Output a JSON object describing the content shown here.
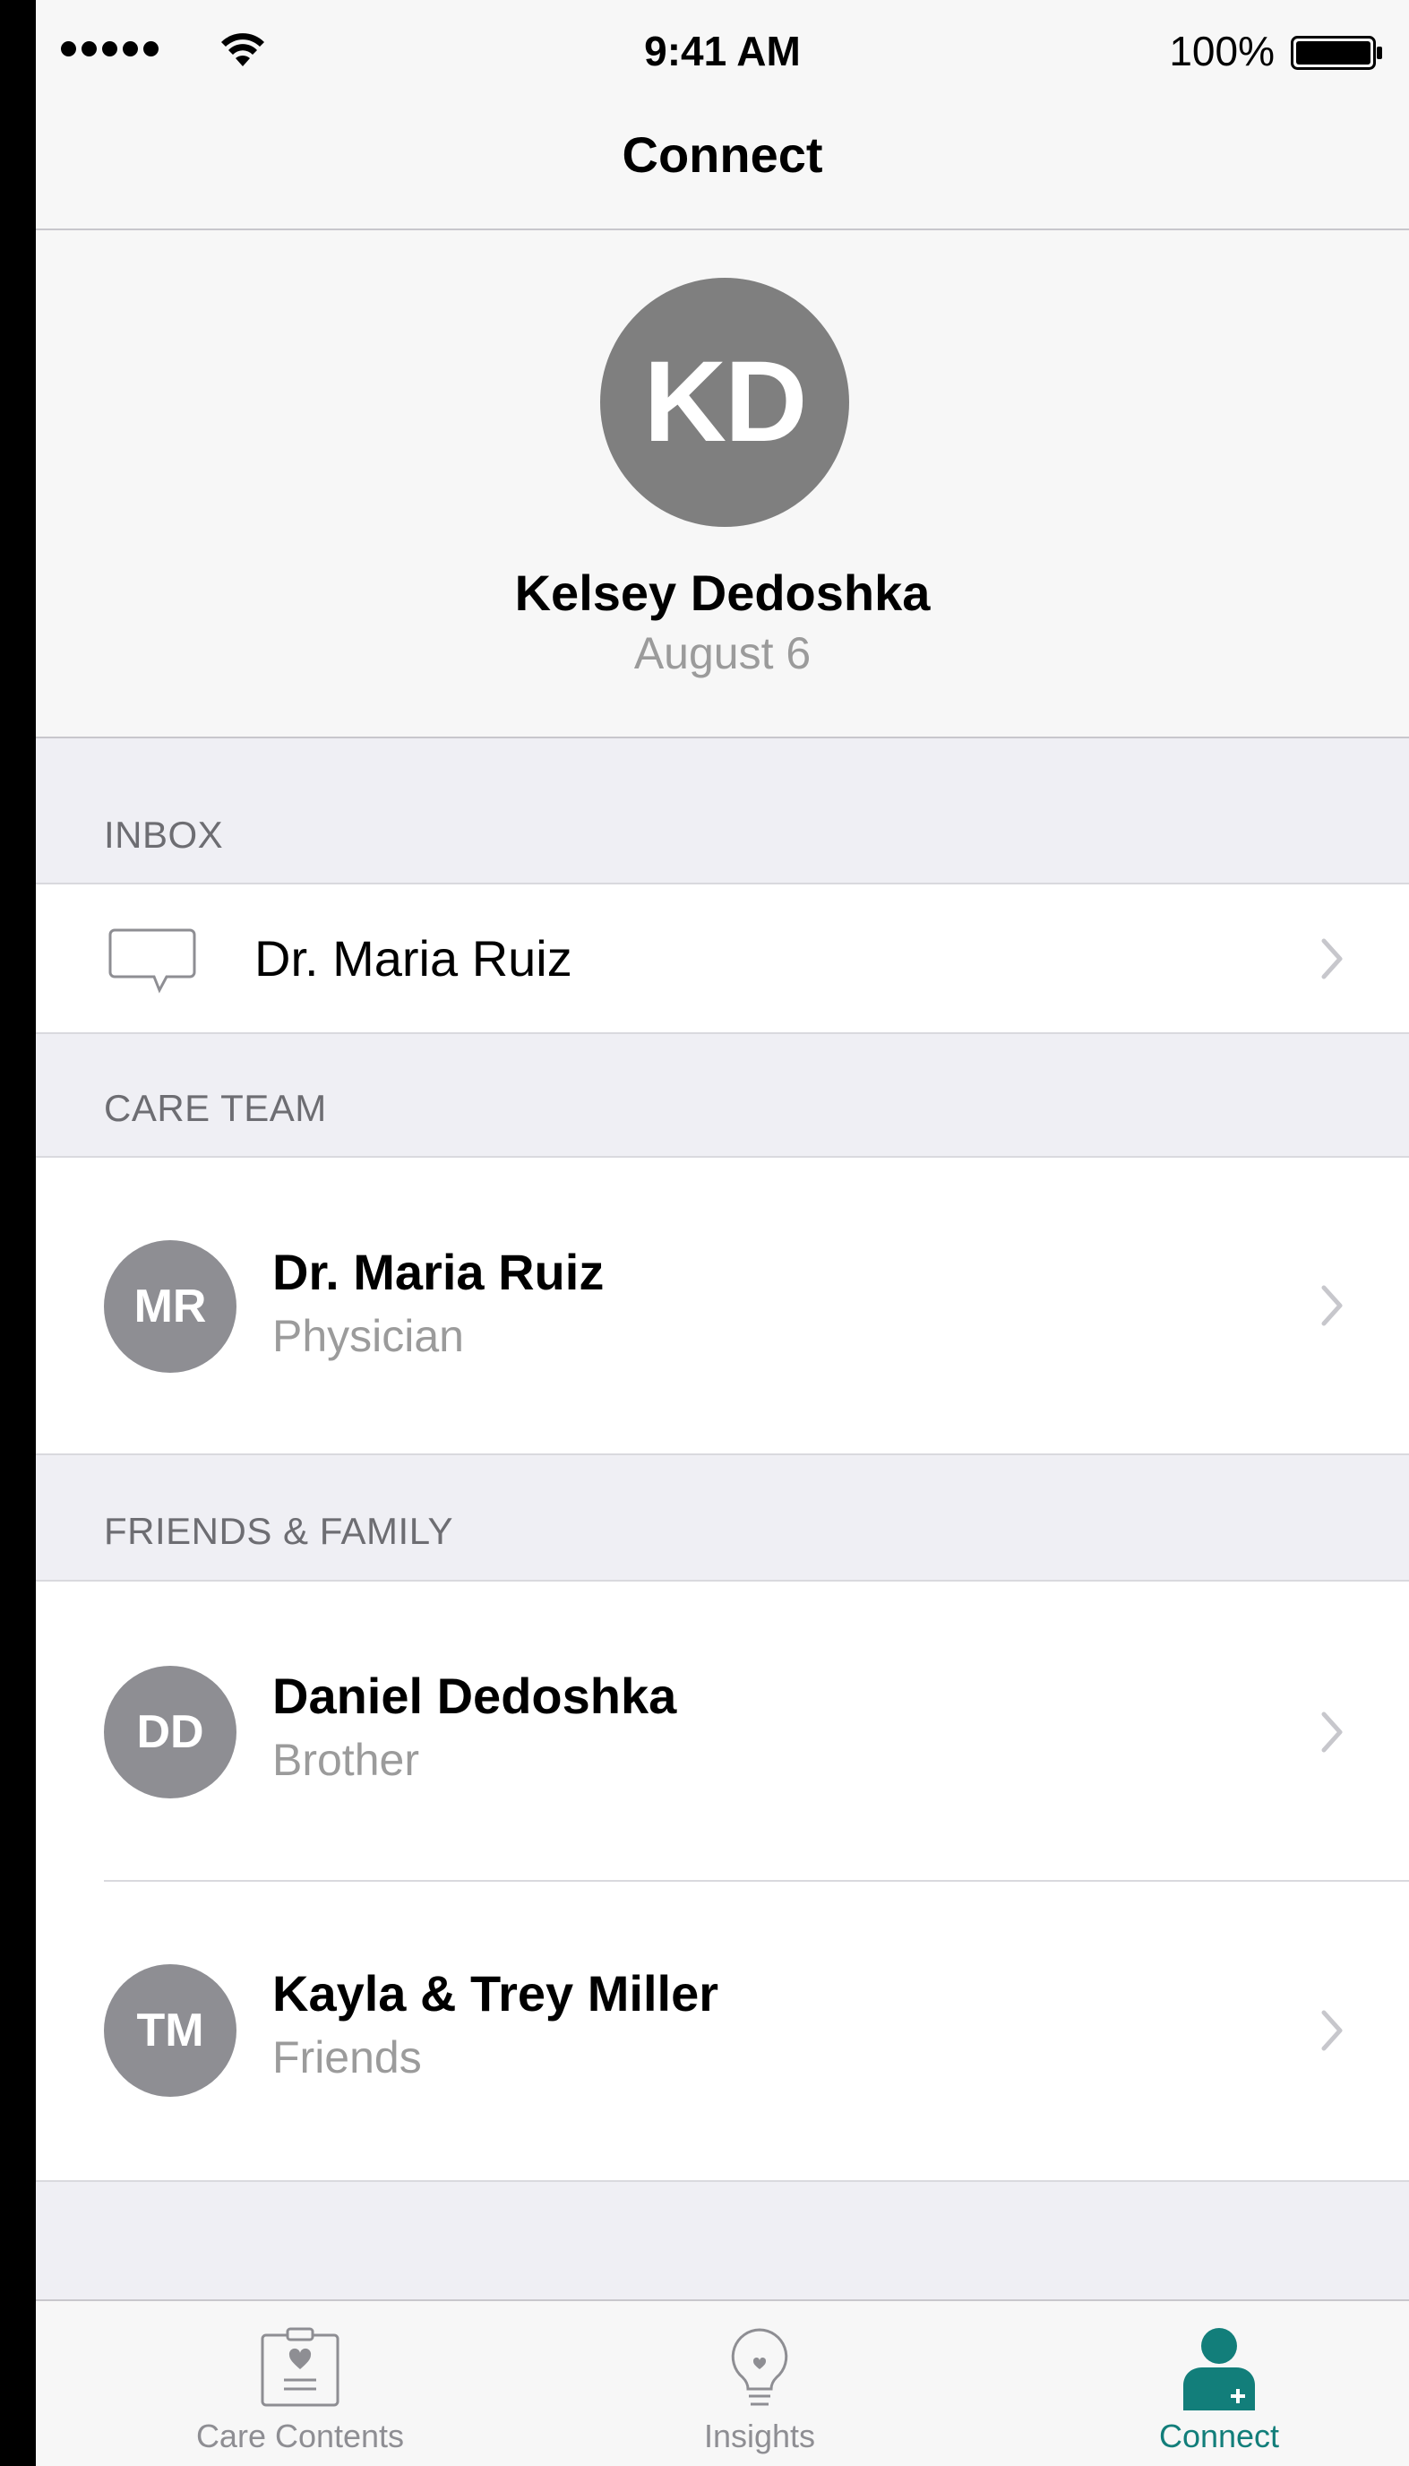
{
  "status_bar": {
    "time": "9:41 AM",
    "battery": "100%"
  },
  "nav": {
    "title": "Connect"
  },
  "profile": {
    "initials": "KD",
    "name": "Kelsey Dedoshka",
    "date": "August 6"
  },
  "inbox": {
    "header": "INBOX",
    "items": [
      {
        "label": "Dr. Maria Ruiz",
        "icon": "chat-bubble-icon"
      }
    ]
  },
  "care_team": {
    "header": "CARE TEAM",
    "members": [
      {
        "initials": "MR",
        "name": "Dr. Maria Ruiz",
        "role": "Physician"
      }
    ]
  },
  "friends_family": {
    "header": "FRIENDS & FAMILY",
    "members": [
      {
        "initials": "DD",
        "name": "Daniel Dedoshka",
        "role": "Brother"
      },
      {
        "initials": "TM",
        "name": "Kayla & Trey Miller",
        "role": "Friends"
      }
    ]
  },
  "tab_bar": {
    "tabs": [
      {
        "label": "Care Contents",
        "icon": "clipboard-heart-icon",
        "active": false
      },
      {
        "label": "Insights",
        "icon": "lightbulb-icon",
        "active": false
      },
      {
        "label": "Connect",
        "icon": "person-plus-icon",
        "active": true
      }
    ]
  },
  "colors": {
    "accent": "#127e7a",
    "avatar_gray": "#8e8e93",
    "secondary_text": "#9b9b9b",
    "background": "#efeff4"
  }
}
